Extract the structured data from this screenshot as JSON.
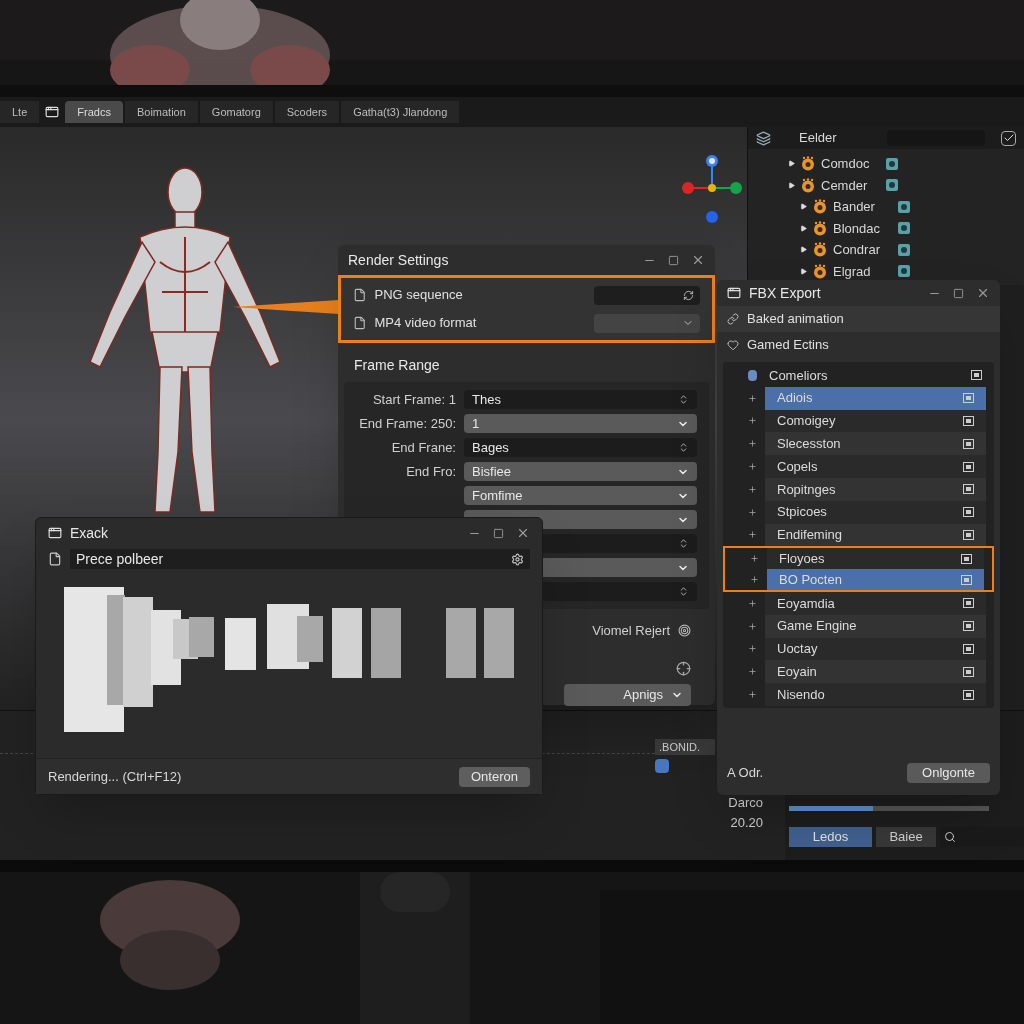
{
  "tabs": [
    {
      "label": "Lte",
      "selected": false
    },
    {
      "label": "Fradcs",
      "selected": true
    },
    {
      "label": "Boimation",
      "selected": false
    },
    {
      "label": "Gomatorg",
      "selected": false
    },
    {
      "label": "Scoders",
      "selected": false
    },
    {
      "label": "Gatha(t3) Jlandong",
      "selected": false
    }
  ],
  "outliner": {
    "title": "Eelder",
    "filter_checked": true,
    "items": [
      {
        "label": "Comdoc"
      },
      {
        "label": "Cemder",
        "children": [
          {
            "label": "Bander"
          },
          {
            "label": "Blondac"
          },
          {
            "label": "Condrar"
          },
          {
            "label": "Elgrad"
          }
        ]
      }
    ]
  },
  "render_settings": {
    "title": "Render Settings",
    "formats_highlighted": true,
    "formats": [
      {
        "label": "PNG sequence",
        "kind": "spinner"
      },
      {
        "label": "MP4 video format",
        "kind": "dropdown"
      }
    ],
    "section": "Frame Range",
    "fields": [
      {
        "label": "Start Frame: 1",
        "value": "Thes",
        "kind": "spin"
      },
      {
        "label": "End Frame: 250:",
        "value": "1",
        "kind": "drop"
      },
      {
        "label": "End Frane:",
        "value": "Bages",
        "kind": "spin"
      },
      {
        "label": "End Fro:",
        "value": "Bisfiee",
        "kind": "drop"
      },
      {
        "value": "Fomfime",
        "kind": "drop"
      },
      {
        "kind": "drop"
      },
      {
        "kind": "spin"
      },
      {
        "kind": "drop"
      },
      {
        "kind": "spin"
      }
    ],
    "link": "Viomel Rejert",
    "button": "Apnigs"
  },
  "fbx_export": {
    "title": "FBX Export",
    "options": [
      "Baked animation",
      "Gamed Ectins"
    ],
    "list": [
      {
        "label": "Comeliors",
        "kind": "group",
        "selected": false,
        "highlighted": false
      },
      {
        "label": "Adiois",
        "kind": "item",
        "selected": true,
        "highlighted": false
      },
      {
        "label": "Comoigey",
        "kind": "item",
        "selected": false,
        "highlighted": false
      },
      {
        "label": "Slecesston",
        "kind": "item",
        "selected": false,
        "highlighted": false
      },
      {
        "label": "Copels",
        "kind": "item",
        "selected": false,
        "highlighted": false
      },
      {
        "label": "Ropitnges",
        "kind": "item",
        "selected": false,
        "highlighted": false
      },
      {
        "label": "Stpicoes",
        "kind": "item",
        "selected": false,
        "highlighted": false
      },
      {
        "label": "Endifeming",
        "kind": "item",
        "selected": false,
        "highlighted": false
      },
      {
        "label": "Floyoes",
        "kind": "item",
        "selected": false,
        "highlighted": true
      },
      {
        "label": "BO Pocten",
        "kind": "item",
        "selected": true,
        "highlighted": true
      },
      {
        "label": "Eoyamdia",
        "kind": "item",
        "selected": false,
        "highlighted": false
      },
      {
        "label": "Game Engine",
        "kind": "item",
        "selected": false,
        "highlighted": false
      },
      {
        "label": "Uoctay",
        "kind": "item",
        "selected": false,
        "highlighted": false
      },
      {
        "label": "Eoyain",
        "kind": "item",
        "selected": false,
        "highlighted": false
      },
      {
        "label": "Nisendo",
        "kind": "item",
        "selected": false,
        "highlighted": false
      }
    ],
    "footer": "A Odr.",
    "button": "Onlgonte"
  },
  "exack": {
    "title": "Exack",
    "field": "Prece polbeer",
    "status": "Rendering... (Ctrl+F12)",
    "button": "Onteron"
  },
  "timeline": {
    "marker": ".BONID.",
    "level": 0.42,
    "readings": [
      "Darco",
      "20.20"
    ],
    "tabs": [
      {
        "label": "Ledos",
        "selected": true
      },
      {
        "label": "Baiee",
        "selected": false
      }
    ]
  }
}
